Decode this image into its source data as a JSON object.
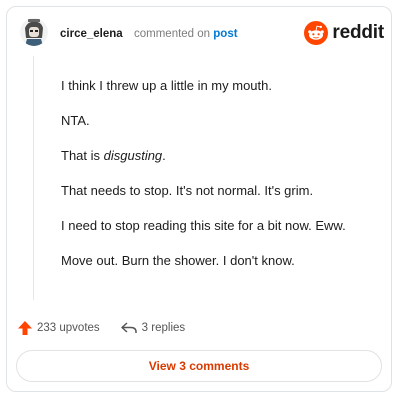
{
  "comment": {
    "username": "circe_elena",
    "action_text": "commented on",
    "post_link": "post",
    "body_paragraphs": [
      {
        "before": "I think I threw up a little in my mouth.",
        "emph": "",
        "after": ""
      },
      {
        "before": "NTA.",
        "emph": "",
        "after": ""
      },
      {
        "before": "That is ",
        "emph": "disgusting",
        "after": "."
      },
      {
        "before": "That needs to stop. It's not normal. It's grim.",
        "emph": "",
        "after": ""
      },
      {
        "before": "I need to stop reading this site for a bit now. Eww.",
        "emph": "",
        "after": ""
      },
      {
        "before": "Move out. Burn the shower. I don't know.",
        "emph": "",
        "after": ""
      }
    ]
  },
  "brand": {
    "wordmark": "reddit",
    "icon": "reddit-snoo-icon",
    "color": "#ff4500"
  },
  "footer": {
    "upvotes_label": "233 upvotes",
    "upvote_icon": "upvote-arrow-icon",
    "upvote_color": "#ff4500",
    "replies_label": "3 replies",
    "reply_icon": "reply-arrow-icon"
  },
  "view_comments": {
    "label": "View 3 comments",
    "color": "#d93a00"
  }
}
